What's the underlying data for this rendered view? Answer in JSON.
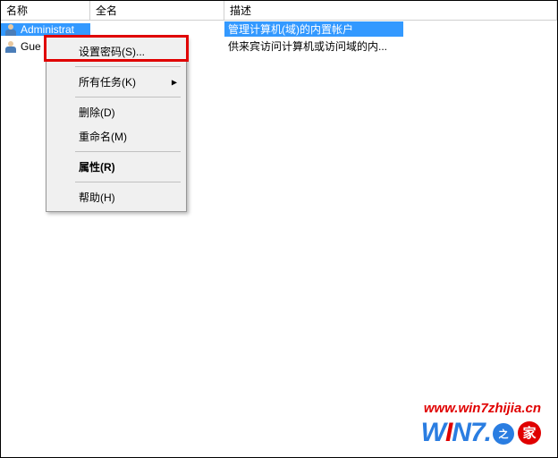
{
  "columns": {
    "name": "名称",
    "fullname": "全名",
    "description": "描述"
  },
  "rows": [
    {
      "name": "Administrat",
      "fullname": "",
      "description": "管理计算机(域)的内置帐户"
    },
    {
      "name": "Gue",
      "fullname": "",
      "description": "供来宾访问计算机或访问域的内..."
    }
  ],
  "context_menu": {
    "set_password": "设置密码(S)...",
    "all_tasks": "所有任务(K)",
    "delete": "删除(D)",
    "rename": "重命名(M)",
    "properties": "属性(R)",
    "help": "帮助(H)"
  },
  "watermark": {
    "url": "www.win7zhijia.cn",
    "brand_w": "W",
    "brand_i": "I",
    "brand_n": "N",
    "brand_7": "7.",
    "badge": "之",
    "jia": "家"
  }
}
